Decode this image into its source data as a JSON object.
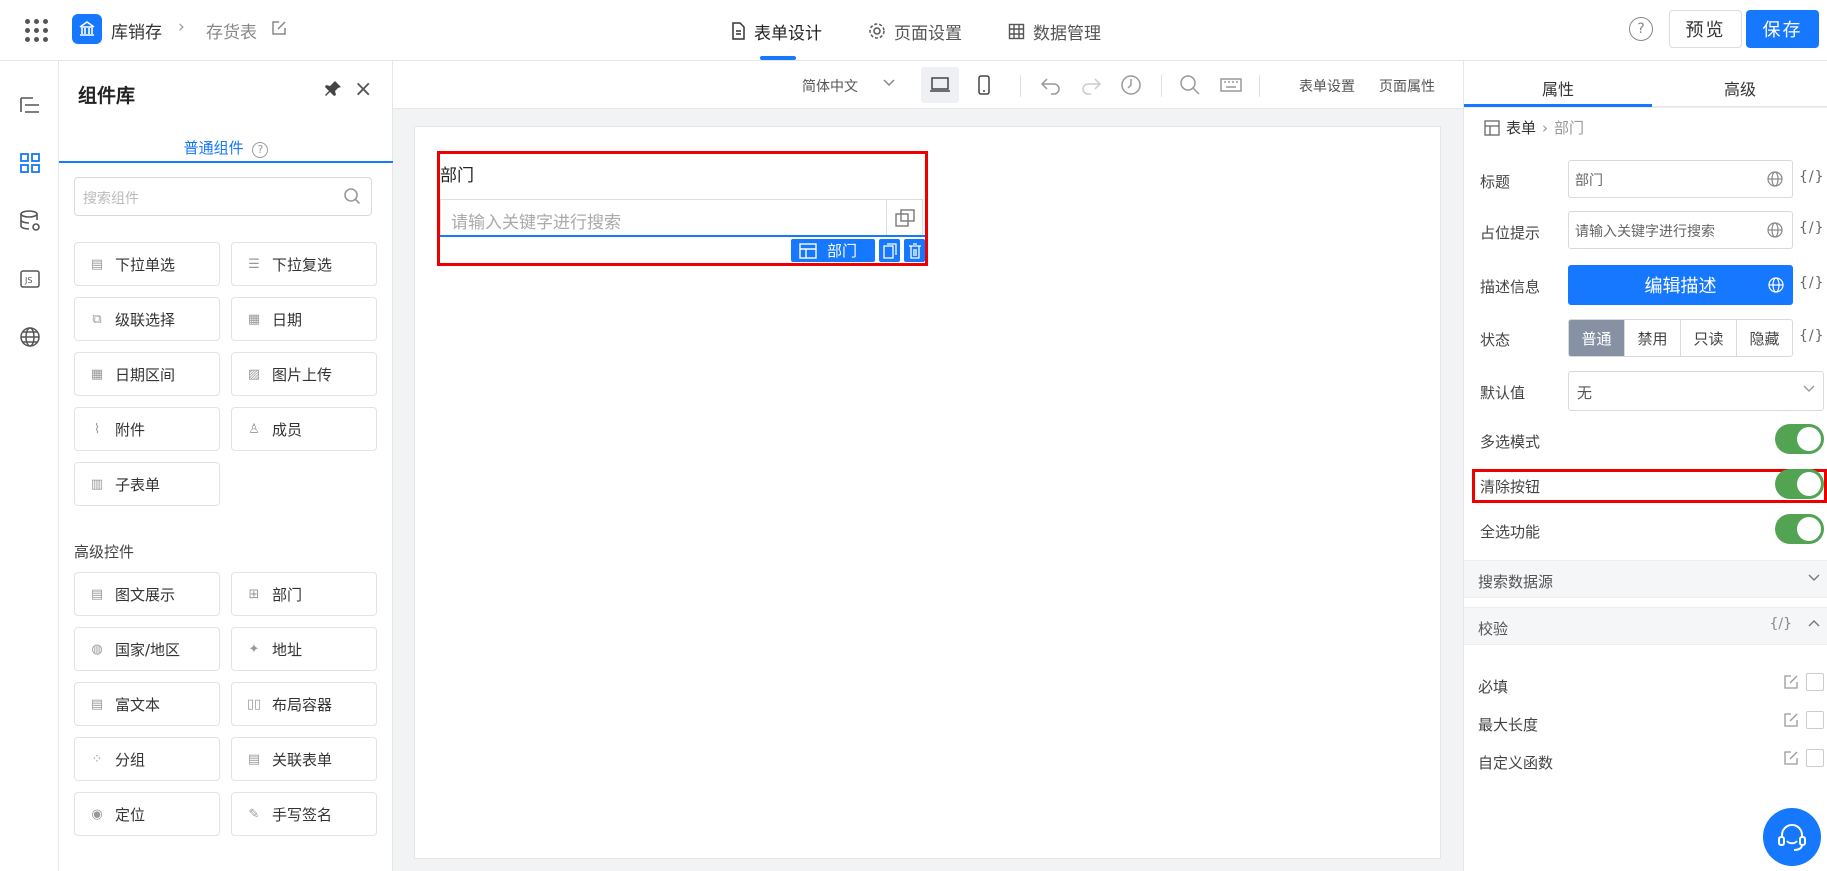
{
  "header": {
    "app_name": "库销存",
    "sheet_name": "存货表",
    "tabs": [
      {
        "label": "表单设计"
      },
      {
        "label": "页面设置"
      },
      {
        "label": "数据管理"
      }
    ],
    "help_label": "?",
    "preview_label": "预览",
    "save_label": "保存"
  },
  "library": {
    "title": "组件库",
    "tab_label": "普通组件",
    "search_placeholder": "搜索组件",
    "basic": [
      {
        "label": "下拉单选",
        "icon": "select-icon"
      },
      {
        "label": "下拉复选",
        "icon": "checklist-icon"
      },
      {
        "label": "级联选择",
        "icon": "cascade-icon"
      },
      {
        "label": "日期",
        "icon": "calendar-icon"
      },
      {
        "label": "日期区间",
        "icon": "calendar-range-icon"
      },
      {
        "label": "图片上传",
        "icon": "image-icon"
      },
      {
        "label": "附件",
        "icon": "paperclip-icon"
      },
      {
        "label": "成员",
        "icon": "user-icon"
      },
      {
        "label": "子表单",
        "icon": "subform-icon"
      }
    ],
    "advanced_title": "高级控件",
    "advanced": [
      {
        "label": "图文展示",
        "icon": "richtext-display-icon"
      },
      {
        "label": "部门",
        "icon": "department-icon"
      },
      {
        "label": "国家/地区",
        "icon": "globe-icon"
      },
      {
        "label": "地址",
        "icon": "map-icon"
      },
      {
        "label": "富文本",
        "icon": "rich-text-icon"
      },
      {
        "label": "布局容器",
        "icon": "layout-icon"
      },
      {
        "label": "分组",
        "icon": "group-icon"
      },
      {
        "label": "关联表单",
        "icon": "link-form-icon"
      },
      {
        "label": "定位",
        "icon": "location-icon"
      },
      {
        "label": "手写签名",
        "icon": "signature-icon"
      }
    ]
  },
  "toolbar": {
    "language": "简体中文",
    "form_settings": "表单设置",
    "page_props": "页面属性"
  },
  "canvas": {
    "field_label": "部门",
    "field_placeholder": "请输入关键字进行搜索",
    "selected_tag": "部门"
  },
  "props": {
    "tab_props": "属性",
    "tab_advanced": "高级",
    "crumb_root": "表单",
    "crumb_leaf": "部门",
    "fx": "{/}",
    "title_label": "标题",
    "title_value": "部门",
    "placeholder_label": "占位提示",
    "placeholder_value": "请输入关键字进行搜索",
    "desc_label": "描述信息",
    "desc_button": "编辑描述",
    "state_label": "状态",
    "states": [
      "普通",
      "禁用",
      "只读",
      "隐藏"
    ],
    "default_label": "默认值",
    "default_value": "无",
    "multi_label": "多选模式",
    "multi_on": true,
    "clear_label": "清除按钮",
    "clear_on": true,
    "selectall_label": "全选功能",
    "selectall_on": true,
    "datasource_label": "搜索数据源",
    "validation_label": "校验",
    "validations": [
      {
        "label": "必填"
      },
      {
        "label": "最大长度"
      },
      {
        "label": "自定义函数"
      }
    ]
  },
  "colors": {
    "accent": "#1677ff",
    "toggle_on": "#52a352",
    "highlight": "#e00000"
  }
}
